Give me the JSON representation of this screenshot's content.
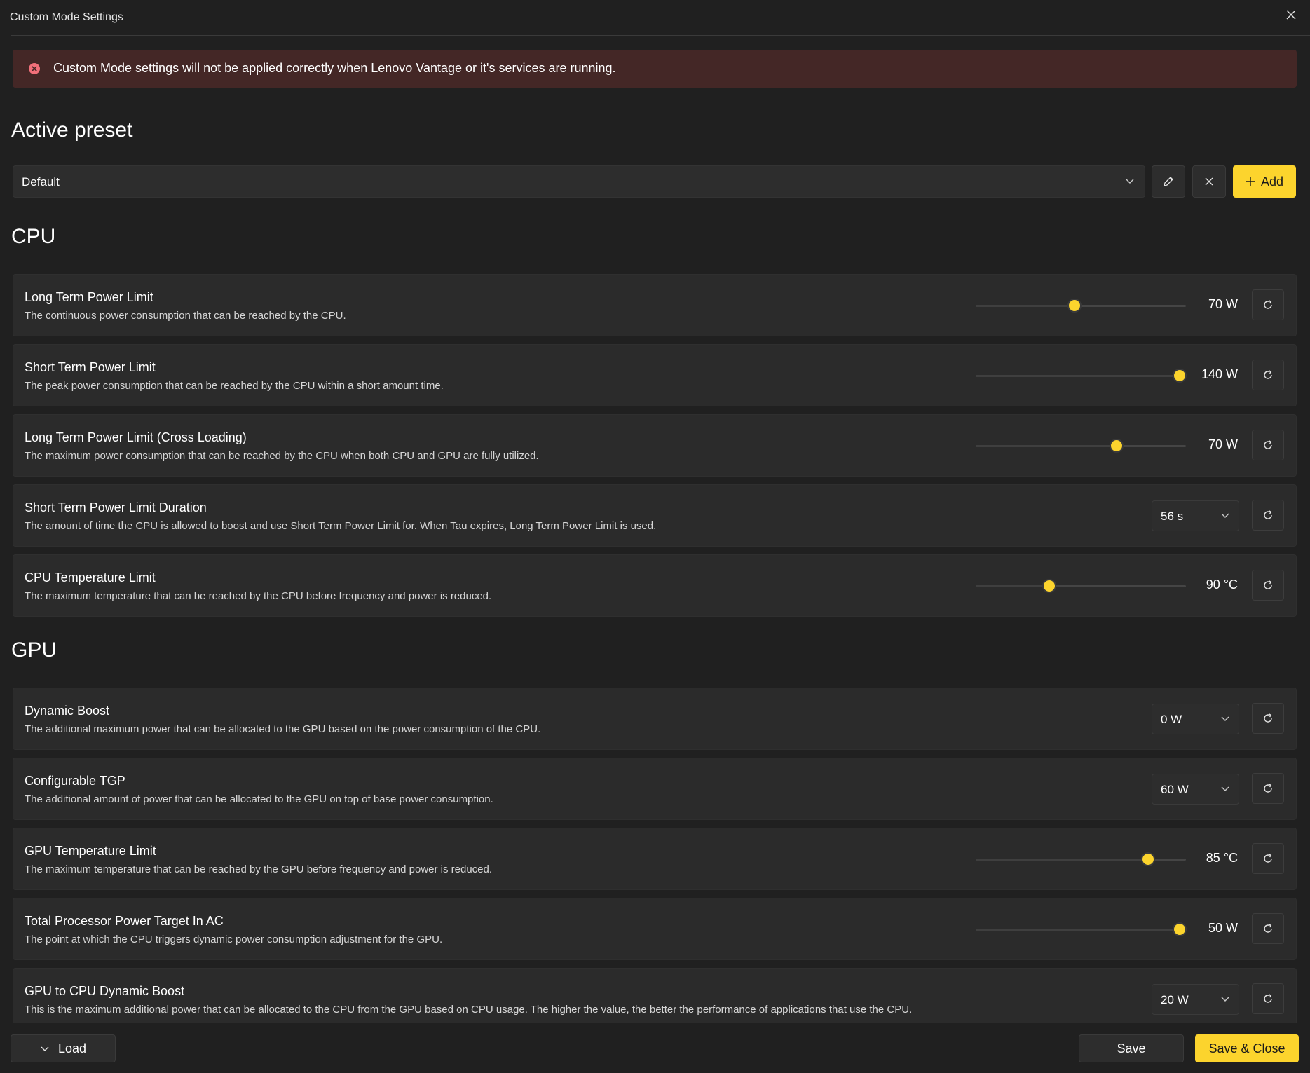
{
  "window": {
    "title": "Custom Mode Settings"
  },
  "banner": {
    "message": "Custom Mode settings will not be applied correctly when Lenovo Vantage or it's services are running."
  },
  "preset": {
    "heading": "Active preset",
    "selected": "Default",
    "add_label": "Add"
  },
  "cpu": {
    "heading": "CPU",
    "items": [
      {
        "title": "Long Term Power Limit",
        "desc": "The continuous power consumption that can be reached by the CPU.",
        "control": "slider",
        "value": "70 W",
        "fraction": 0.47
      },
      {
        "title": "Short Term Power Limit",
        "desc": "The peak power consumption that can be reached by the CPU within a short amount time.",
        "control": "slider",
        "value": "140 W",
        "fraction": 0.97
      },
      {
        "title": "Long Term Power Limit (Cross Loading)",
        "desc": "The maximum power consumption that can be reached by the CPU when both CPU and GPU are fully utilized.",
        "control": "slider",
        "value": "70 W",
        "fraction": 0.67
      },
      {
        "title": "Short Term Power Limit Duration",
        "desc": "The amount of time the CPU is allowed to boost and use Short Term Power Limit for. When Tau expires, Long Term Power Limit is used.",
        "control": "dropdown",
        "value": "56 s"
      },
      {
        "title": "CPU Temperature Limit",
        "desc": "The maximum temperature that can be reached by the CPU before frequency and power is reduced.",
        "control": "slider",
        "value": "90 °C",
        "fraction": 0.35
      }
    ]
  },
  "gpu": {
    "heading": "GPU",
    "items": [
      {
        "title": "Dynamic Boost",
        "desc": "The additional maximum power that can be allocated to the GPU based on the power consumption of the CPU.",
        "control": "dropdown",
        "value": "0 W"
      },
      {
        "title": "Configurable TGP",
        "desc": "The additional amount of power that can be allocated to the GPU on top of base power consumption.",
        "control": "dropdown",
        "value": "60 W"
      },
      {
        "title": "GPU Temperature Limit",
        "desc": "The maximum temperature that can be reached by the GPU before frequency and power is reduced.",
        "control": "slider",
        "value": "85 °C",
        "fraction": 0.82
      },
      {
        "title": "Total Processor Power Target In AC",
        "desc": "The point at which the CPU triggers dynamic power consumption adjustment for the GPU.",
        "control": "slider",
        "value": "50 W",
        "fraction": 0.97
      },
      {
        "title": "GPU to CPU Dynamic Boost",
        "desc": "This is the maximum additional power that can be allocated to the CPU from the GPU based on CPU usage. The higher the value, the better the performance of applications that use the CPU.",
        "control": "dropdown",
        "value": "20 W"
      }
    ]
  },
  "footer": {
    "load_label": "Load",
    "save_label": "Save",
    "save_close_label": "Save & Close"
  },
  "colors": {
    "accent": "#fcd42d",
    "banner_bg": "#442726",
    "error": "#f1707a"
  }
}
